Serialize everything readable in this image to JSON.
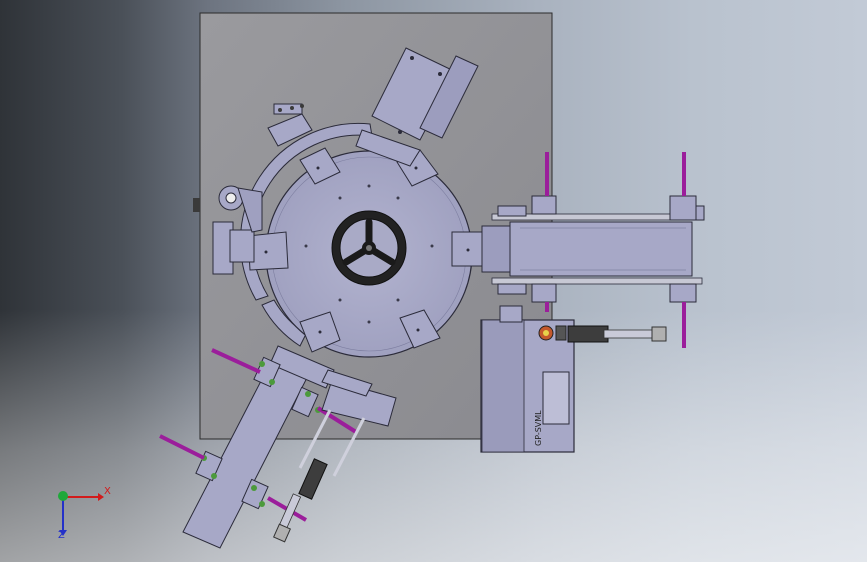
{
  "viewport": {
    "background_start": "#2f3338",
    "background_end": "#c2cad6"
  },
  "model": {
    "plate_color": "#8f8f94",
    "part_color": "#a7a8c7",
    "part_stroke": "#2b2b3a",
    "rod_color": "#9b1e9b",
    "fastener_color": "#4c9a3c",
    "display_text": "GP-SVML"
  },
  "triad": {
    "x_label": "X",
    "z_label": "Z",
    "x_color": "#d21b1b",
    "y_color": "#1fa83a",
    "z_color": "#2431c9"
  }
}
